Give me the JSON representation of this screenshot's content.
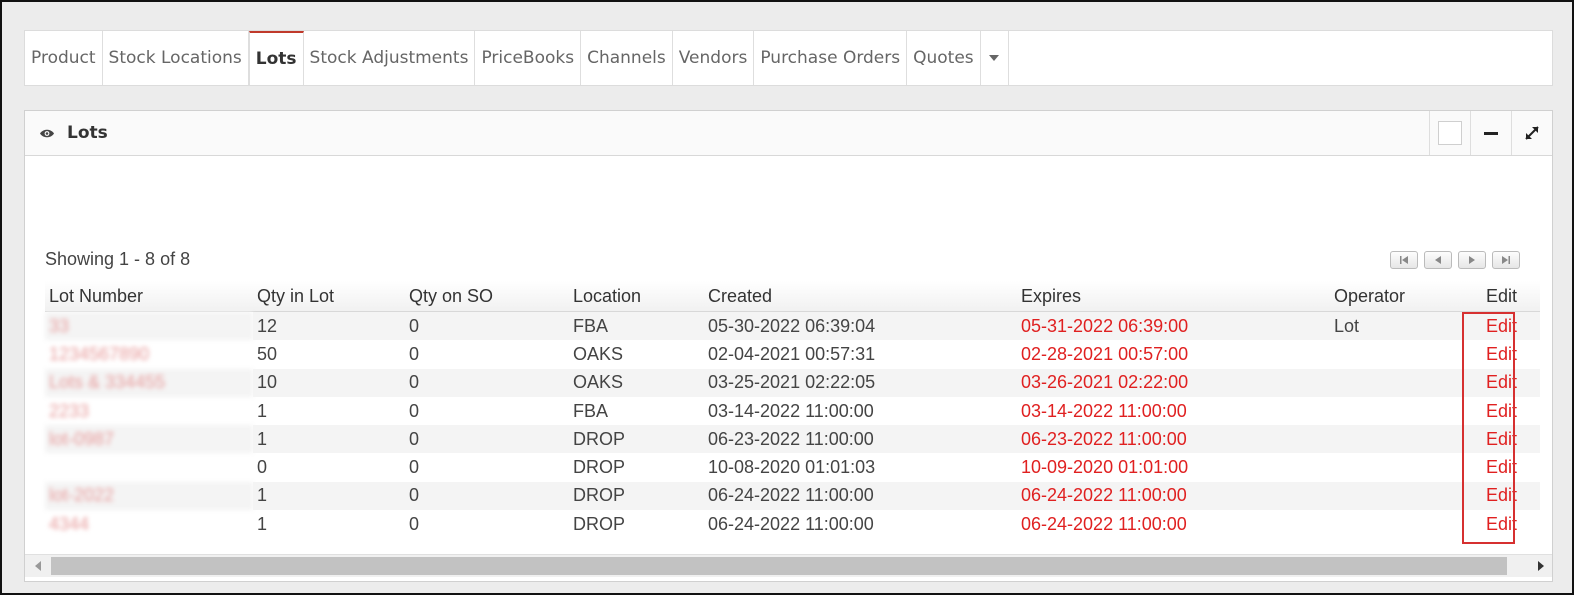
{
  "tabs": [
    {
      "label": "Product",
      "active": false
    },
    {
      "label": "Stock Locations",
      "active": false
    },
    {
      "label": "Lots",
      "active": true
    },
    {
      "label": "Stock Adjustments",
      "active": false
    },
    {
      "label": "PriceBooks",
      "active": false
    },
    {
      "label": "Channels",
      "active": false
    },
    {
      "label": "Vendors",
      "active": false
    },
    {
      "label": "Purchase Orders",
      "active": false
    },
    {
      "label": "Quotes",
      "active": false
    }
  ],
  "panel": {
    "title": "Lots",
    "showing": "Showing 1 - 8 of 8"
  },
  "table": {
    "columns": [
      "Lot Number",
      "Qty in Lot",
      "Qty on SO",
      "Location",
      "Created",
      "Expires",
      "Operator",
      "Edit"
    ],
    "rows": [
      {
        "lot": "33",
        "qty": "12",
        "qty_so": "0",
        "location": "FBA",
        "created": "05-30-2022 06:39:04",
        "expires": "05-31-2022 06:39:00",
        "operator": "Lot",
        "edit": "Edit"
      },
      {
        "lot": "1234567890",
        "qty": "50",
        "qty_so": "0",
        "location": "OAKS",
        "created": "02-04-2021 00:57:31",
        "expires": "02-28-2021 00:57:00",
        "operator": "",
        "edit": "Edit"
      },
      {
        "lot": "Lots & 334455",
        "qty": "10",
        "qty_so": "0",
        "location": "OAKS",
        "created": "03-25-2021 02:22:05",
        "expires": "03-26-2021 02:22:00",
        "operator": "",
        "edit": "Edit"
      },
      {
        "lot": "2233",
        "qty": "1",
        "qty_so": "0",
        "location": "FBA",
        "created": "03-14-2022 11:00:00",
        "expires": "03-14-2022 11:00:00",
        "operator": "",
        "edit": "Edit"
      },
      {
        "lot": "lot-0987",
        "qty": "1",
        "qty_so": "0",
        "location": "DROP",
        "created": "06-23-2022 11:00:00",
        "expires": "06-23-2022 11:00:00",
        "operator": "",
        "edit": "Edit"
      },
      {
        "lot": "",
        "qty": "0",
        "qty_so": "0",
        "location": "DROP",
        "created": "10-08-2020 01:01:03",
        "expires": "10-09-2020 01:01:00",
        "operator": "",
        "edit": "Edit"
      },
      {
        "lot": "lot-2022",
        "qty": "1",
        "qty_so": "0",
        "location": "DROP",
        "created": "06-24-2022 11:00:00",
        "expires": "06-24-2022 11:00:00",
        "operator": "",
        "edit": "Edit"
      },
      {
        "lot": "4344",
        "qty": "1",
        "qty_so": "0",
        "location": "DROP",
        "created": "06-24-2022 11:00:00",
        "expires": "06-24-2022 11:00:00",
        "operator": "",
        "edit": "Edit"
      }
    ]
  },
  "colors": {
    "accent": "#c0392b",
    "expires": "#e02020"
  },
  "icons": {
    "panel": "eye-icon",
    "tabs_more": "caret-down-icon"
  }
}
